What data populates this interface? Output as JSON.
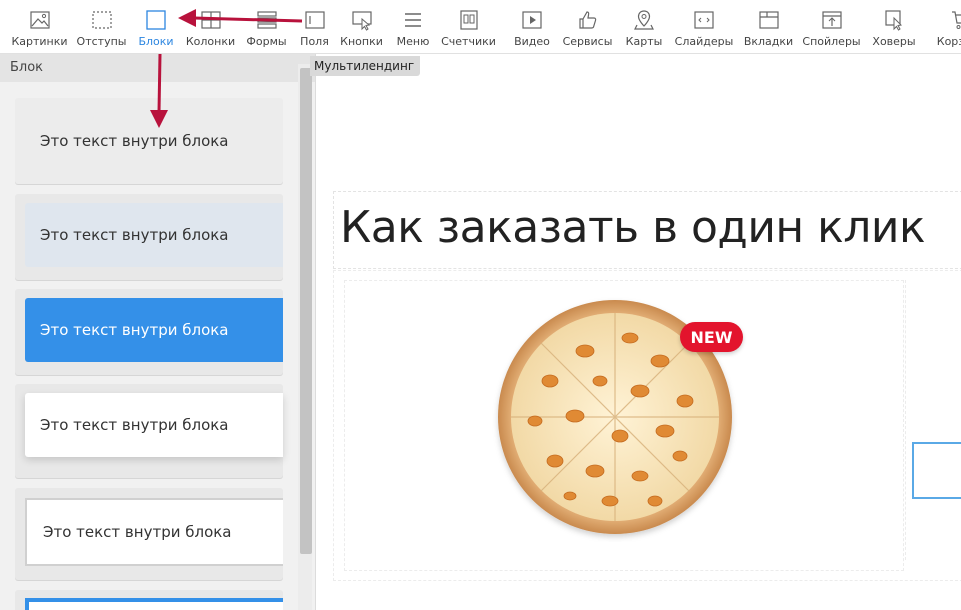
{
  "toolbar": {
    "items": [
      {
        "label": "Картинки",
        "icon": "image-icon"
      },
      {
        "label": "Отступы",
        "icon": "padding-icon"
      },
      {
        "label": "Блоки",
        "icon": "block-icon",
        "active": true
      },
      {
        "label": "Колонки",
        "icon": "columns-icon"
      },
      {
        "label": "Формы",
        "icon": "forms-icon"
      },
      {
        "label": "Поля",
        "icon": "field-icon"
      },
      {
        "label": "Кнопки",
        "icon": "button-cursor-icon"
      },
      {
        "label": "Меню",
        "icon": "menu-icon"
      },
      {
        "label": "Счетчики",
        "icon": "counter-icon"
      },
      {
        "label": "Видео",
        "icon": "video-icon"
      },
      {
        "label": "Сервисы",
        "icon": "thumbs-up-icon"
      },
      {
        "label": "Карты",
        "icon": "map-pin-icon"
      },
      {
        "label": "Слайдеры",
        "icon": "slider-icon"
      },
      {
        "label": "Вкладки",
        "icon": "tabs-icon"
      },
      {
        "label": "Спойлеры",
        "icon": "spoiler-icon"
      },
      {
        "label": "Ховеры",
        "icon": "hover-icon"
      },
      {
        "label": "Корзина",
        "icon": "cart-icon"
      }
    ],
    "active_color": "#2d86e0"
  },
  "sidebar": {
    "title": "Блок",
    "blocks": [
      {
        "text": "Это текст внутри блока",
        "style": "plain-gray"
      },
      {
        "text": "Это текст внутри блока",
        "style": "light-blue-fill"
      },
      {
        "text": "Это текст внутри блока",
        "style": "blue-fill"
      },
      {
        "text": "Это текст внутри блока",
        "style": "white-shadow"
      },
      {
        "text": "Это текст внутри блока",
        "style": "white-bordered"
      }
    ]
  },
  "canvas": {
    "page_tag": "Мультилендинг",
    "heading": "Как заказать в один клик",
    "badge": "NEW",
    "badge_color": "#e3142d",
    "frame_color": "#5aa9e6"
  }
}
